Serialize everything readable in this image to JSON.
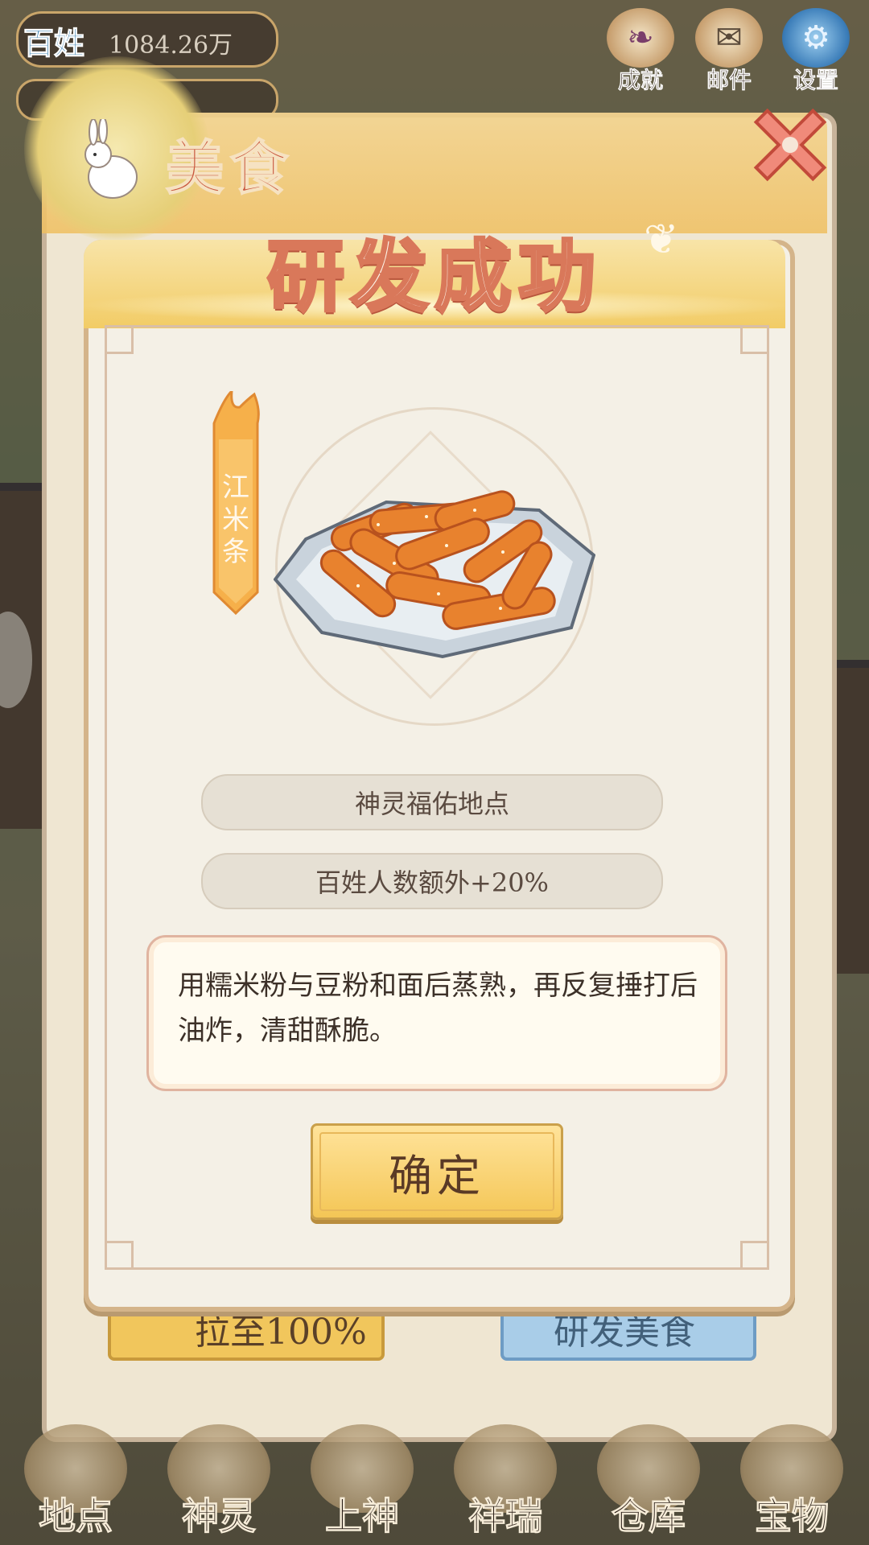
{
  "hud": {
    "badge": "百姓",
    "population": "1084.26万"
  },
  "top_buttons": [
    {
      "label": "成就",
      "icon": "scroll-icon"
    },
    {
      "label": "邮件",
      "icon": "mail-icon"
    },
    {
      "label": "设置",
      "icon": "gear-icon"
    }
  ],
  "panel": {
    "title": "美食",
    "left_button_label": "拉至100%",
    "right_button_label": "研发美食"
  },
  "dialog": {
    "title": "研发成功",
    "dish_name": "江米条",
    "effect_target": "神灵福佑地点",
    "effect_bonus": "百姓人数额外+20%",
    "description": "用糯米粉与豆粉和面后蒸熟，再反复捶打后油炸，清甜酥脆。",
    "confirm_label": "确定"
  },
  "bottom_nav": [
    {
      "label": "地点"
    },
    {
      "label": "神灵"
    },
    {
      "label": "上神"
    },
    {
      "label": "祥瑞"
    },
    {
      "label": "仓库"
    },
    {
      "label": "宝物"
    }
  ],
  "colors": {
    "title_stroke": "#d9785a",
    "header_gold": "#f2cc66",
    "confirm_gold": "#f4c656"
  }
}
